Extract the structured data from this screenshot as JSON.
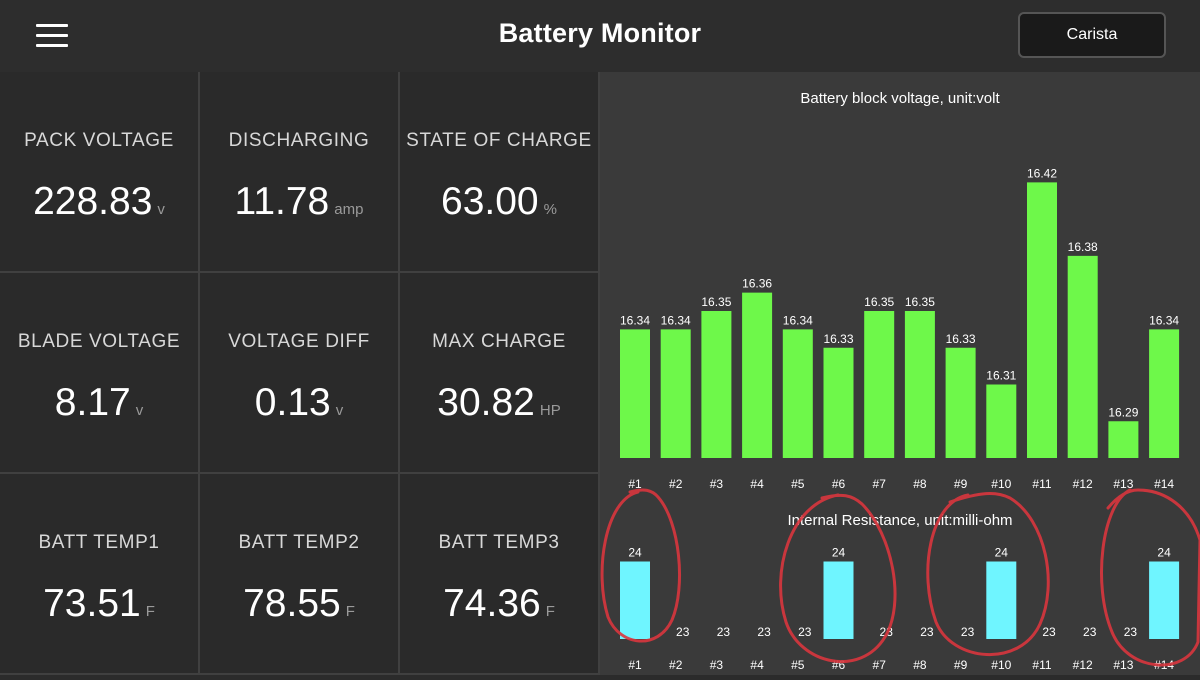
{
  "header": {
    "title": "Battery Monitor",
    "button_label": "Carista"
  },
  "tiles": [
    {
      "label": "PACK VOLTAGE",
      "value": "228.83",
      "unit": "v"
    },
    {
      "label": "DISCHARGING",
      "value": "11.78",
      "unit": "amp"
    },
    {
      "label": "STATE OF CHARGE",
      "value": "63.00",
      "unit": "%"
    },
    {
      "label": "BLADE VOLTAGE",
      "value": "8.17",
      "unit": "v"
    },
    {
      "label": "VOLTAGE DIFF",
      "value": "0.13",
      "unit": "v"
    },
    {
      "label": "MAX CHARGE",
      "value": "30.82",
      "unit": "HP"
    },
    {
      "label": "BATT TEMP1",
      "value": "73.51",
      "unit": "F"
    },
    {
      "label": "BATT TEMP2",
      "value": "78.55",
      "unit": "F"
    },
    {
      "label": "BATT TEMP3",
      "value": "74.36",
      "unit": "F"
    }
  ],
  "colors": {
    "voltage_bar": "#6ef84a",
    "resistance_bar": "#6ff5ff",
    "annotation": "#d9363e"
  },
  "chart_data": [
    {
      "type": "bar",
      "title": "Battery block voltage, unit:volt",
      "categories": [
        "#1",
        "#2",
        "#3",
        "#4",
        "#5",
        "#6",
        "#7",
        "#8",
        "#9",
        "#10",
        "#11",
        "#12",
        "#13",
        "#14"
      ],
      "values": [
        16.34,
        16.34,
        16.35,
        16.36,
        16.34,
        16.33,
        16.35,
        16.35,
        16.33,
        16.31,
        16.42,
        16.38,
        16.29,
        16.34
      ],
      "value_labels": [
        "16.34",
        "16.34",
        "16.35",
        "16.36",
        "16.34",
        "16.33",
        "16.35",
        "16.35",
        "16.33",
        "16.31",
        "16.42",
        "16.38",
        "16.29",
        "16.34"
      ],
      "ylim": [
        16.27,
        16.43
      ],
      "grid": false
    },
    {
      "type": "bar",
      "title": "Internal Resistance, unit:milli-ohm",
      "categories": [
        "#1",
        "#2",
        "#3",
        "#4",
        "#5",
        "#6",
        "#7",
        "#8",
        "#9",
        "#10",
        "#11",
        "#12",
        "#13",
        "#14"
      ],
      "values": [
        24,
        23,
        23,
        23,
        23,
        24,
        23,
        23,
        23,
        24,
        23,
        23,
        23,
        24
      ],
      "value_labels": [
        "24",
        "23",
        "23",
        "23",
        "23",
        "24",
        "23",
        "23",
        "23",
        "24",
        "23",
        "23",
        "23",
        "24"
      ],
      "ylim": [
        23,
        24.2
      ],
      "grid": false
    }
  ]
}
